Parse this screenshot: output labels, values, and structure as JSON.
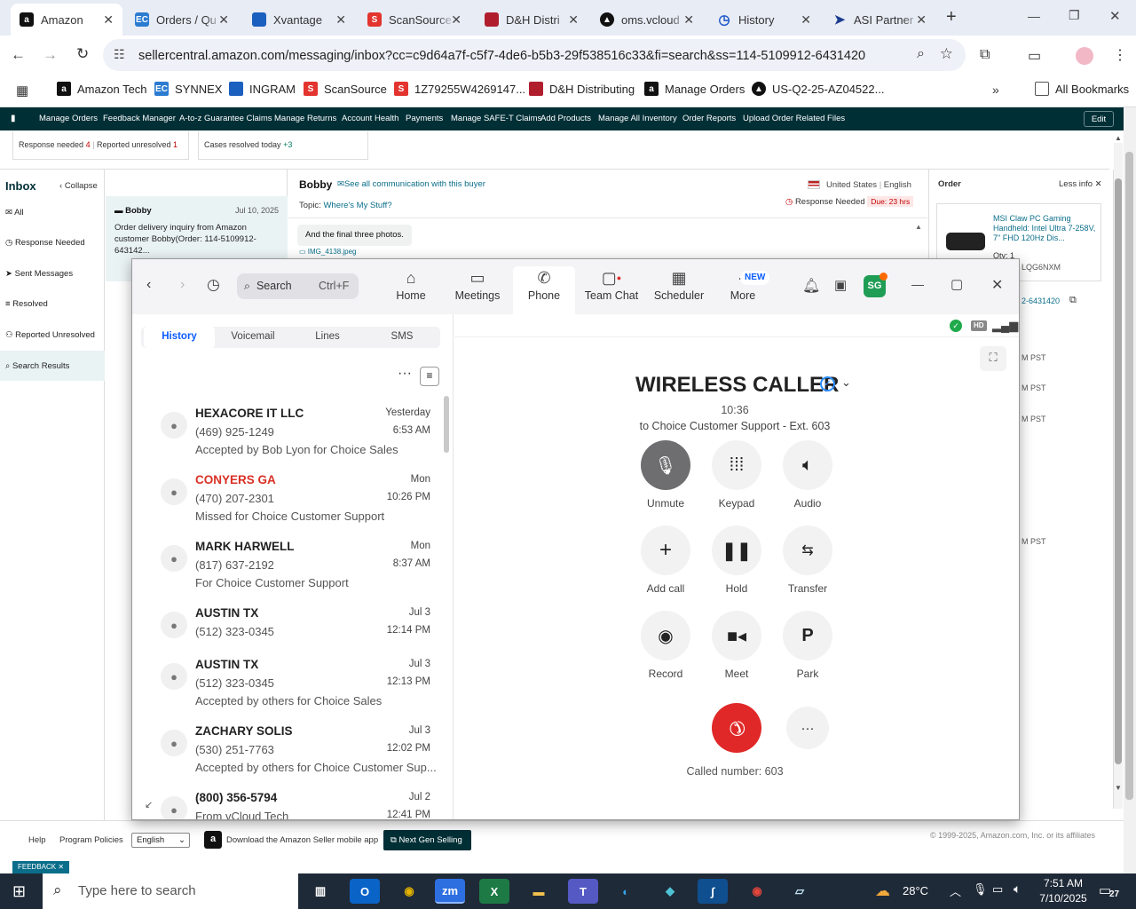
{
  "browser": {
    "tabs": [
      {
        "label": "Amazon",
        "active": true
      },
      {
        "label": "Orders / Qu"
      },
      {
        "label": "Xvantage"
      },
      {
        "label": "ScanSource"
      },
      {
        "label": "D&H Distri"
      },
      {
        "label": "oms.vcloud"
      },
      {
        "label": "History"
      },
      {
        "label": "ASI Partner"
      }
    ],
    "url": "sellercentral.amazon.com/messaging/inbox?cc=c9d64a7f-c5f7-4de6-b5b3-29f538516c33&fi=search&ss=114-5109912-6431420",
    "bookmarks": [
      "Amazon Tech",
      "SYNNEX",
      "INGRAM",
      "ScanSource",
      "1Z79255W4269147...",
      "D&H Distributing",
      "Manage Orders",
      "US-Q2-25-AZ04522..."
    ],
    "all_bookmarks": "All Bookmarks"
  },
  "amazon": {
    "nav": [
      "Manage Orders",
      "Feedback Manager",
      "A-to-z Guarantee Claims",
      "Manage Returns",
      "Account Health",
      "Payments",
      "Manage SAFE-T Claims",
      "Add Products",
      "Manage All Inventory",
      "Order Reports",
      "Upload Order Related Files"
    ],
    "edit": "Edit",
    "cards": {
      "response_needed": "Response needed",
      "response_needed_count": "4",
      "reported_unresolved": "Reported unresolved",
      "reported_unresolved_count": "1",
      "cases_resolved": "Cases resolved today",
      "cases_resolved_count": "+3"
    },
    "inbox": {
      "title": "Inbox",
      "collapse": "Collapse",
      "items": [
        "All",
        "Response Needed",
        "Sent Messages",
        "Resolved",
        "Reported Unresolved",
        "Search Results"
      ]
    },
    "conversation": {
      "name": "Bobby",
      "date": "Jul 10, 2025",
      "preview": "Order delivery inquiry from Amazon customer Bobby(Order: 114-5109912-643142..."
    },
    "message": {
      "buyer": "Bobby",
      "see_all": "See all communication with this buyer",
      "locale": "United States",
      "language": "English",
      "topic_label": "Topic:",
      "topic": "Where's My Stuff?",
      "response_needed": "Response Needed",
      "due": "Due: 23 hrs",
      "bubble": "And the final three photos.",
      "attachment": "IMG_4138.jpeg"
    },
    "order": {
      "title": "Order",
      "less_info": "Less info",
      "product": "MSI Claw PC Gaming Handheld: Intel Ultra 7-258V, 7\" FHD 120Hz Dis...",
      "qty": "Qty: 1",
      "sku_partial": "LQG6NXM",
      "order_partial": "2-6431420",
      "times": [
        "M PST",
        "M PST",
        "M PST",
        "M PST"
      ]
    },
    "footer": {
      "help": "Help",
      "policies": "Program Policies",
      "language": "English",
      "app": "Download the Amazon Seller mobile app",
      "next_gen": "Next Gen Selling",
      "copyright": "© 1999-2025, Amazon.com, Inc. or its affiliates",
      "feedback": "FEEDBACK"
    }
  },
  "zoom": {
    "search": "Search",
    "shortcut": "Ctrl+F",
    "nav": [
      {
        "label": "Home",
        "icon": "home-icon"
      },
      {
        "label": "Meetings",
        "icon": "camera-icon"
      },
      {
        "label": "Phone",
        "icon": "phone-icon"
      },
      {
        "label": "Team Chat",
        "icon": "chat-icon"
      },
      {
        "label": "Scheduler",
        "icon": "calendar-icon"
      },
      {
        "label": "More",
        "icon": "more-icon"
      }
    ],
    "new_badge": "NEW",
    "avatar": "SG",
    "tabs": [
      "History",
      "Voicemail",
      "Lines",
      "SMS"
    ],
    "history": [
      {
        "name": "HEXACORE IT LLC",
        "phone": "(469) 925-1249",
        "status": "Accepted by Bob Lyon for Choice Sales",
        "date": "Yesterday",
        "time": "6:53 AM"
      },
      {
        "name": "CONYERS GA",
        "phone": "(470) 207-2301",
        "status": "Missed for Choice Customer Support",
        "date": "Mon",
        "time": "10:26 PM",
        "missed": true
      },
      {
        "name": "MARK HARWELL",
        "phone": "(817) 637-2192",
        "status": "For Choice Customer Support",
        "date": "Mon",
        "time": "8:37 AM"
      },
      {
        "name": "AUSTIN TX",
        "phone": "(512) 323-0345",
        "status": "",
        "date": "Jul 3",
        "time": "12:14 PM"
      },
      {
        "name": "AUSTIN TX",
        "phone": "(512) 323-0345",
        "status": "Accepted by others for Choice Sales",
        "date": "Jul 3",
        "time": "12:13 PM"
      },
      {
        "name": "ZACHARY SOLIS",
        "phone": "(530) 251-7763",
        "status": "Accepted by others for Choice Customer Sup...",
        "date": "Jul 3",
        "time": "12:02 PM"
      },
      {
        "name": "(800) 356-5794",
        "phone": "",
        "status": "From vCloud Tech",
        "date": "Jul 2",
        "time": "12:41 PM"
      }
    ],
    "call": {
      "caller": "WIRELESS CALLER",
      "duration": "10:36",
      "to": "to Choice Customer Support - Ext. 603",
      "buttons": [
        "Unmute",
        "Keypad",
        "Audio",
        "Add call",
        "Hold",
        "Transfer",
        "Record",
        "Meet",
        "Park"
      ],
      "park_glyph": "P",
      "hd": "HD",
      "called_number": "Called number: 603"
    }
  },
  "taskbar": {
    "search": "Type here to search",
    "temp": "28°C",
    "time": "7:51 AM",
    "date": "7/10/2025",
    "notif": "27"
  }
}
